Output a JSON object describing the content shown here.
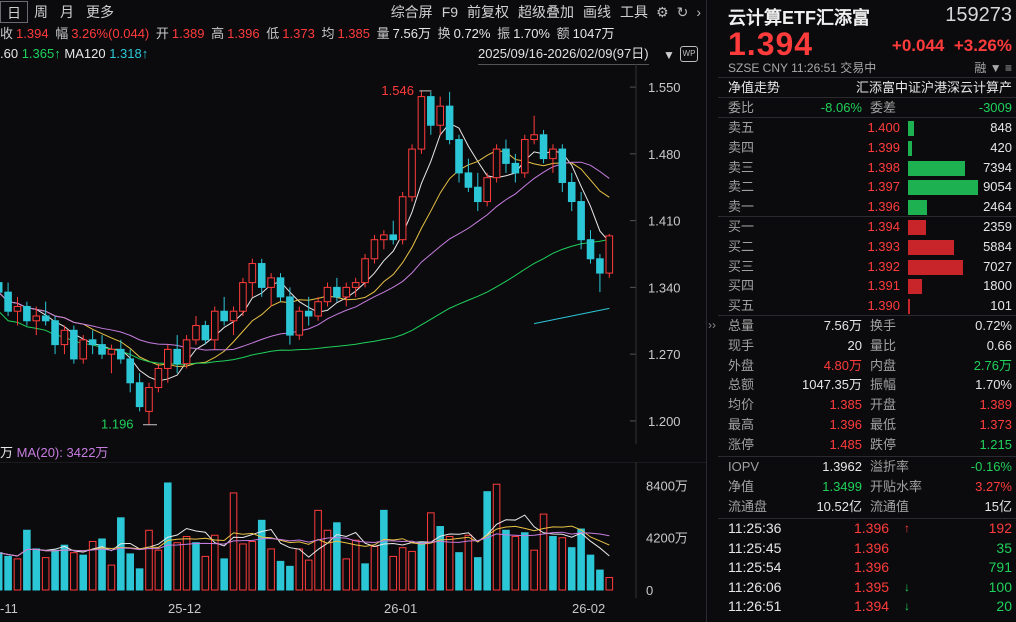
{
  "colors": {
    "up": "#ff3b3b",
    "down": "#1fd15a",
    "cyan": "#2cc7d6",
    "ma5": "#e8e8e8",
    "ma10": "#e8c244",
    "ma20": "#c77ddf",
    "ma60": "#1fd15a",
    "ma120": "#2cc7d6"
  },
  "toolbar": {
    "tabs": [
      "日",
      "周",
      "月",
      "更多"
    ],
    "tools": [
      "综合屏",
      "F9",
      "前复权",
      "超级叠加",
      "画线",
      "工具"
    ],
    "icons": [
      "gear-icon",
      "refresh-icon",
      "chevron-right-icon"
    ],
    "wp_label": "WP"
  },
  "info": {
    "close_label": "收",
    "close": "1.394",
    "amp_label": "幅",
    "amp": "3.26%(0.044)",
    "open_label": "开",
    "open": "1.389",
    "high_label": "高",
    "high": "1.396",
    "low_label": "低",
    "low": "1.373",
    "avg_label": "均",
    "avg": "1.385",
    "vol_label": "量",
    "vol": "7.56万",
    "turn_label": "换",
    "turn": "0.72%",
    "swing_label": "振",
    "swing": "1.70%",
    "amount_label": "额",
    "amount": "1047万"
  },
  "ma_row": {
    "ma60_tail": ".60",
    "ma60_val": "1.365↑",
    "ma120_label": "MA120",
    "ma120_val": "1.318↑"
  },
  "date_range": "2025/09/16-2026/02/09(97日)",
  "kline": {
    "y_ticks": [
      "1.550",
      "1.480",
      "1.410",
      "1.340",
      "1.270",
      "1.200"
    ],
    "high_marker": "1.546",
    "low_marker": "1.196"
  },
  "volume": {
    "header_lead": "万",
    "ma_label": "MA(20):",
    "ma_value": "3422万",
    "y_ticks": [
      "8400万",
      "4200万",
      "0"
    ]
  },
  "date_axis": [
    "-11",
    "25-12",
    "26-01",
    "26-02"
  ],
  "quote": {
    "name": "云计算ETF汇添富",
    "code": "159273",
    "price": "1.394",
    "change": "+0.044",
    "change_pct": "+3.26%",
    "meta": "SZSE CNY 11:26:51 交易中",
    "meta_icons": [
      "融",
      "▼",
      "≡"
    ],
    "nav_label": "净值走势",
    "index_name": "汇添富中证沪港深云计算产",
    "weibi_label": "委比",
    "weibi": "-8.06%",
    "weicha_label": "委差",
    "weicha": "-3009",
    "asks": [
      {
        "label": "卖五",
        "price": "1.400",
        "vol": "848",
        "frac": 0.09
      },
      {
        "label": "卖四",
        "price": "1.399",
        "vol": "420",
        "frac": 0.05
      },
      {
        "label": "卖三",
        "price": "1.398",
        "vol": "7394",
        "frac": 0.82
      },
      {
        "label": "卖二",
        "price": "1.397",
        "vol": "9054",
        "frac": 1.0
      },
      {
        "label": "卖一",
        "price": "1.396",
        "vol": "2464",
        "frac": 0.27
      }
    ],
    "bids": [
      {
        "label": "买一",
        "price": "1.394",
        "vol": "2359",
        "frac": 0.26
      },
      {
        "label": "买二",
        "price": "1.393",
        "vol": "5884",
        "frac": 0.65
      },
      {
        "label": "买三",
        "price": "1.392",
        "vol": "7027",
        "frac": 0.78
      },
      {
        "label": "买四",
        "price": "1.391",
        "vol": "1800",
        "frac": 0.2
      },
      {
        "label": "买五",
        "price": "1.390",
        "vol": "101",
        "frac": 0.01
      }
    ],
    "stats": [
      {
        "l": "总量",
        "lv": "7.56万",
        "lc": "white",
        "r": "换手",
        "rv": "0.72%",
        "rc": "white"
      },
      {
        "l": "现手",
        "lv": "20",
        "lc": "white",
        "r": "量比",
        "rv": "0.66",
        "rc": "white"
      },
      {
        "l": "外盘",
        "lv": "4.80万",
        "lc": "red",
        "r": "内盘",
        "rv": "2.76万",
        "rc": "green"
      },
      {
        "l": "总额",
        "lv": "1047.35万",
        "lc": "white",
        "r": "振幅",
        "rv": "1.70%",
        "rc": "white"
      },
      {
        "l": "均价",
        "lv": "1.385",
        "lc": "red",
        "r": "开盘",
        "rv": "1.389",
        "rc": "red"
      },
      {
        "l": "最高",
        "lv": "1.396",
        "lc": "red",
        "r": "最低",
        "rv": "1.373",
        "rc": "red"
      },
      {
        "l": "涨停",
        "lv": "1.485",
        "lc": "red",
        "r": "跌停",
        "rv": "1.215",
        "rc": "green"
      }
    ],
    "etf": [
      {
        "l": "IOPV",
        "lv": "1.3962",
        "lc": "white",
        "r": "溢折率",
        "rv": "-0.16%",
        "rc": "green"
      },
      {
        "l": "净值",
        "lv": "1.3499",
        "lc": "green",
        "r": "开贴水率",
        "rv": "3.27%",
        "rc": "red"
      },
      {
        "l": "流通盘",
        "lv": "10.52亿",
        "lc": "white",
        "r": "流通值",
        "rv": "15亿",
        "rc": "white"
      }
    ],
    "ticks": [
      {
        "time": "11:25:36",
        "price": "1.396",
        "dir": "↑",
        "vol": "192",
        "vc": "red"
      },
      {
        "time": "11:25:45",
        "price": "1.396",
        "dir": "",
        "vol": "35",
        "vc": "green"
      },
      {
        "time": "11:25:54",
        "price": "1.396",
        "dir": "",
        "vol": "791",
        "vc": "green"
      },
      {
        "time": "11:26:06",
        "price": "1.395",
        "dir": "↓",
        "vol": "100",
        "vc": "green"
      },
      {
        "time": "11:26:51",
        "price": "1.394",
        "dir": "↓",
        "vol": "20",
        "vc": "green"
      }
    ]
  },
  "chart_data": {
    "type": "candlestick",
    "ylim": [
      1.18,
      1.57
    ],
    "vol_max": 9000,
    "candles": [
      [
        1.345,
        1.36,
        1.33,
        1.335
      ],
      [
        1.335,
        1.345,
        1.31,
        1.315
      ],
      [
        1.315,
        1.33,
        1.3,
        1.32
      ],
      [
        1.32,
        1.325,
        1.3,
        1.305
      ],
      [
        1.305,
        1.32,
        1.29,
        1.31
      ],
      [
        1.31,
        1.325,
        1.3,
        1.305
      ],
      [
        1.305,
        1.31,
        1.27,
        1.28
      ],
      [
        1.28,
        1.3,
        1.27,
        1.295
      ],
      [
        1.295,
        1.3,
        1.26,
        1.265
      ],
      [
        1.265,
        1.29,
        1.26,
        1.285
      ],
      [
        1.285,
        1.295,
        1.27,
        1.28
      ],
      [
        1.28,
        1.29,
        1.265,
        1.27
      ],
      [
        1.27,
        1.28,
        1.25,
        1.275
      ],
      [
        1.275,
        1.285,
        1.26,
        1.265
      ],
      [
        1.265,
        1.275,
        1.23,
        1.24
      ],
      [
        1.24,
        1.25,
        1.21,
        1.215
      ],
      [
        1.21,
        1.24,
        1.196,
        1.235
      ],
      [
        1.235,
        1.26,
        1.23,
        1.255
      ],
      [
        1.255,
        1.28,
        1.24,
        1.275
      ],
      [
        1.275,
        1.29,
        1.25,
        1.26
      ],
      [
        1.26,
        1.29,
        1.255,
        1.285
      ],
      [
        1.285,
        1.31,
        1.28,
        1.3
      ],
      [
        1.3,
        1.305,
        1.28,
        1.285
      ],
      [
        1.285,
        1.32,
        1.275,
        1.315
      ],
      [
        1.315,
        1.33,
        1.3,
        1.305
      ],
      [
        1.305,
        1.32,
        1.29,
        1.315
      ],
      [
        1.315,
        1.35,
        1.31,
        1.345
      ],
      [
        1.345,
        1.37,
        1.33,
        1.365
      ],
      [
        1.365,
        1.37,
        1.33,
        1.34
      ],
      [
        1.34,
        1.355,
        1.32,
        1.35
      ],
      [
        1.35,
        1.355,
        1.325,
        1.33
      ],
      [
        1.33,
        1.34,
        1.28,
        1.29
      ],
      [
        1.29,
        1.32,
        1.285,
        1.315
      ],
      [
        1.315,
        1.33,
        1.3,
        1.31
      ],
      [
        1.31,
        1.33,
        1.305,
        1.325
      ],
      [
        1.325,
        1.345,
        1.32,
        1.34
      ],
      [
        1.34,
        1.35,
        1.325,
        1.33
      ],
      [
        1.33,
        1.345,
        1.32,
        1.34
      ],
      [
        1.34,
        1.35,
        1.33,
        1.345
      ],
      [
        1.345,
        1.375,
        1.34,
        1.37
      ],
      [
        1.37,
        1.395,
        1.365,
        1.39
      ],
      [
        1.39,
        1.4,
        1.38,
        1.395
      ],
      [
        1.395,
        1.41,
        1.385,
        1.39
      ],
      [
        1.39,
        1.44,
        1.385,
        1.435
      ],
      [
        1.435,
        1.49,
        1.43,
        1.485
      ],
      [
        1.485,
        1.546,
        1.48,
        1.54
      ],
      [
        1.54,
        1.545,
        1.5,
        1.51
      ],
      [
        1.51,
        1.54,
        1.5,
        1.53
      ],
      [
        1.53,
        1.545,
        1.49,
        1.495
      ],
      [
        1.495,
        1.5,
        1.45,
        1.46
      ],
      [
        1.46,
        1.475,
        1.44,
        1.445
      ],
      [
        1.445,
        1.46,
        1.42,
        1.43
      ],
      [
        1.43,
        1.46,
        1.425,
        1.455
      ],
      [
        1.455,
        1.49,
        1.45,
        1.485
      ],
      [
        1.485,
        1.495,
        1.46,
        1.47
      ],
      [
        1.47,
        1.48,
        1.45,
        1.46
      ],
      [
        1.46,
        1.5,
        1.455,
        1.495
      ],
      [
        1.495,
        1.52,
        1.49,
        1.5
      ],
      [
        1.5,
        1.505,
        1.47,
        1.475
      ],
      [
        1.475,
        1.49,
        1.46,
        1.485
      ],
      [
        1.485,
        1.49,
        1.44,
        1.45
      ],
      [
        1.45,
        1.46,
        1.42,
        1.43
      ],
      [
        1.43,
        1.44,
        1.38,
        1.39
      ],
      [
        1.39,
        1.4,
        1.365,
        1.37
      ],
      [
        1.37,
        1.375,
        1.335,
        1.355
      ],
      [
        1.355,
        1.396,
        1.35,
        1.394
      ]
    ],
    "volumes": [
      [
        3000,
        0
      ],
      [
        2700,
        0
      ],
      [
        2500,
        1
      ],
      [
        4800,
        0
      ],
      [
        3300,
        0
      ],
      [
        2600,
        1
      ],
      [
        3200,
        0
      ],
      [
        3600,
        0
      ],
      [
        3000,
        1
      ],
      [
        2800,
        0
      ],
      [
        3900,
        1
      ],
      [
        4100,
        0
      ],
      [
        2000,
        1
      ],
      [
        5800,
        0
      ],
      [
        2900,
        0
      ],
      [
        1700,
        0
      ],
      [
        4800,
        1
      ],
      [
        3200,
        1
      ],
      [
        8600,
        0
      ],
      [
        3800,
        1
      ],
      [
        4300,
        1
      ],
      [
        3800,
        0
      ],
      [
        2700,
        1
      ],
      [
        4400,
        1
      ],
      [
        2500,
        0
      ],
      [
        7800,
        1
      ],
      [
        3700,
        1
      ],
      [
        3900,
        1
      ],
      [
        5600,
        0
      ],
      [
        3300,
        1
      ],
      [
        2300,
        0
      ],
      [
        1900,
        0
      ],
      [
        3300,
        1
      ],
      [
        2400,
        1
      ],
      [
        6400,
        1
      ],
      [
        4800,
        1
      ],
      [
        5400,
        0
      ],
      [
        2500,
        1
      ],
      [
        4000,
        1
      ],
      [
        2100,
        0
      ],
      [
        3500,
        1
      ],
      [
        6400,
        0
      ],
      [
        2700,
        1
      ],
      [
        3400,
        1
      ],
      [
        3100,
        1
      ],
      [
        3800,
        0
      ],
      [
        6200,
        1
      ],
      [
        5100,
        0
      ],
      [
        4300,
        1
      ],
      [
        3000,
        0
      ],
      [
        4400,
        1
      ],
      [
        2600,
        0
      ],
      [
        7900,
        0
      ],
      [
        8500,
        1
      ],
      [
        4800,
        0
      ],
      [
        4300,
        1
      ],
      [
        4600,
        0
      ],
      [
        3200,
        1
      ],
      [
        6100,
        1
      ],
      [
        4300,
        0
      ],
      [
        4200,
        1
      ],
      [
        3400,
        0
      ],
      [
        4900,
        0
      ],
      [
        2800,
        0
      ],
      [
        1600,
        0
      ],
      [
        1000,
        1
      ]
    ]
  }
}
